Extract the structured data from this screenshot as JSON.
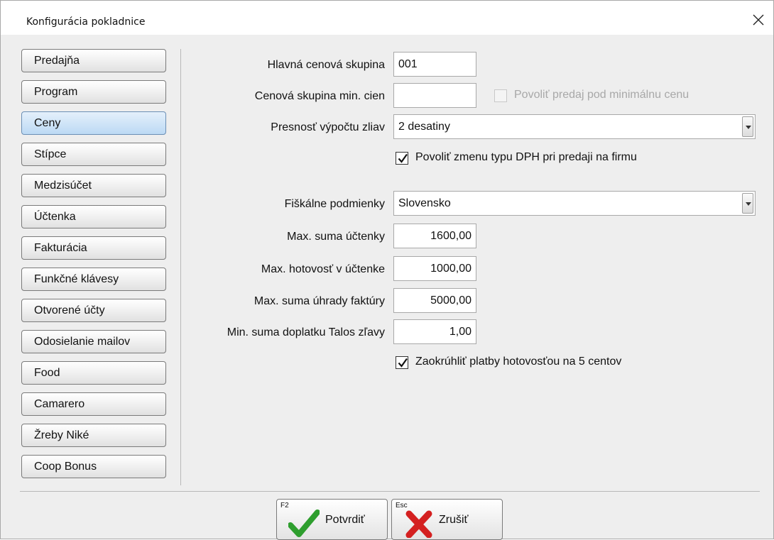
{
  "window": {
    "title": "Konfigurácia pokladnice"
  },
  "sidebar": {
    "items": [
      {
        "label": "Predajňa"
      },
      {
        "label": "Program"
      },
      {
        "label": "Ceny",
        "active": true
      },
      {
        "label": "Stípce"
      },
      {
        "label": "Medzisúčet"
      },
      {
        "label": "Účtenka"
      },
      {
        "label": "Fakturácia"
      },
      {
        "label": "Funkčné klávesy"
      },
      {
        "label": "Otvorené účty"
      },
      {
        "label": "Odosielanie mailov"
      },
      {
        "label": "Food"
      },
      {
        "label": "Camarero"
      },
      {
        "label": "Žreby Niké"
      },
      {
        "label": "Coop Bonus"
      }
    ]
  },
  "form": {
    "main_price_group": {
      "label": "Hlavná cenová skupina",
      "value": "001"
    },
    "min_price_group": {
      "label": "Cenová skupina min. cien",
      "value": ""
    },
    "allow_below_min": {
      "label": "Povoliť predaj pod minimálnu cenu",
      "checked": false,
      "enabled": false
    },
    "discount_precision": {
      "label": "Presnosť výpočtu zliav",
      "value": "2 desatiny"
    },
    "allow_vat_change": {
      "label": "Povoliť zmenu typu DPH pri predaji na firmu",
      "checked": true
    },
    "fiscal_conditions": {
      "label": "Fiškálne podmienky",
      "value": "Slovensko"
    },
    "max_receipt_sum": {
      "label": "Max. suma účtenky",
      "value": "1600,00"
    },
    "max_cash_receipt": {
      "label": "Max. hotovosť v účtenke",
      "value": "1000,00"
    },
    "max_invoice_payment": {
      "label": "Max. suma úhrady faktúry",
      "value": "5000,00"
    },
    "min_talos_surcharge": {
      "label": "Min. suma doplatku Talos zľavy",
      "value": "1,00"
    },
    "round_cash": {
      "label": "Zaokrúhliť platby hotovosťou na 5 centov",
      "checked": true
    }
  },
  "footer": {
    "confirm": {
      "key": "F2",
      "label": "Potvrdiť",
      "icon": "checkmark-icon",
      "color": "#2e9e2e"
    },
    "cancel": {
      "key": "Esc",
      "label": "Zrušiť",
      "icon": "cross-icon",
      "color": "#d42020"
    }
  },
  "colors": {
    "active_nav": "#c9e2f8",
    "window_bg": "#eeeeee"
  }
}
